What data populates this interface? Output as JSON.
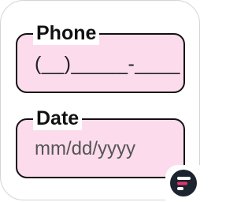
{
  "form": {
    "phone": {
      "label": "Phone",
      "value": "(__)_____-____"
    },
    "date": {
      "label": "Date",
      "placeholder": "mm/dd/yyyy"
    }
  },
  "brand": {
    "icon": "brand-logo-icon"
  },
  "colors": {
    "field_fill": "#fcdcec",
    "field_border": "#111111",
    "brand_bg": "#1c2430",
    "brand_accent": "#e8336f"
  }
}
